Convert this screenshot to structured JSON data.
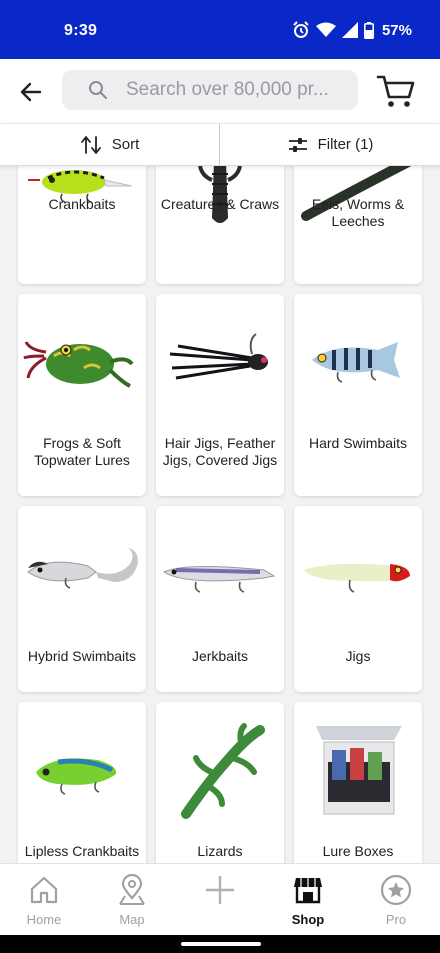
{
  "status": {
    "time": "9:39",
    "battery": "57%"
  },
  "search": {
    "placeholder": "Search over 80,000 pr..."
  },
  "sortbar": {
    "sort_label": "Sort",
    "filter_label": "Filter (1)"
  },
  "categories": [
    {
      "label": "Crankbaits"
    },
    {
      "label": "Creatures & Craws"
    },
    {
      "label": "Eels, Worms & Leeches"
    },
    {
      "label": "Frogs & Soft Topwater Lures"
    },
    {
      "label": "Hair Jigs, Feather Jigs, Covered Jigs"
    },
    {
      "label": "Hard Swimbaits"
    },
    {
      "label": "Hybrid Swimbaits"
    },
    {
      "label": "Jerkbaits"
    },
    {
      "label": "Jigs"
    },
    {
      "label": "Lipless Crankbaits"
    },
    {
      "label": "Lizards"
    },
    {
      "label": "Lure Boxes"
    }
  ],
  "nav": {
    "home": "Home",
    "map": "Map",
    "add": "",
    "shop": "Shop",
    "pro": "Pro",
    "active": "Shop"
  },
  "colors": {
    "status_bar": "#0a28c8",
    "nav_inactive": "#a0a0a6",
    "nav_active": "#111111"
  }
}
